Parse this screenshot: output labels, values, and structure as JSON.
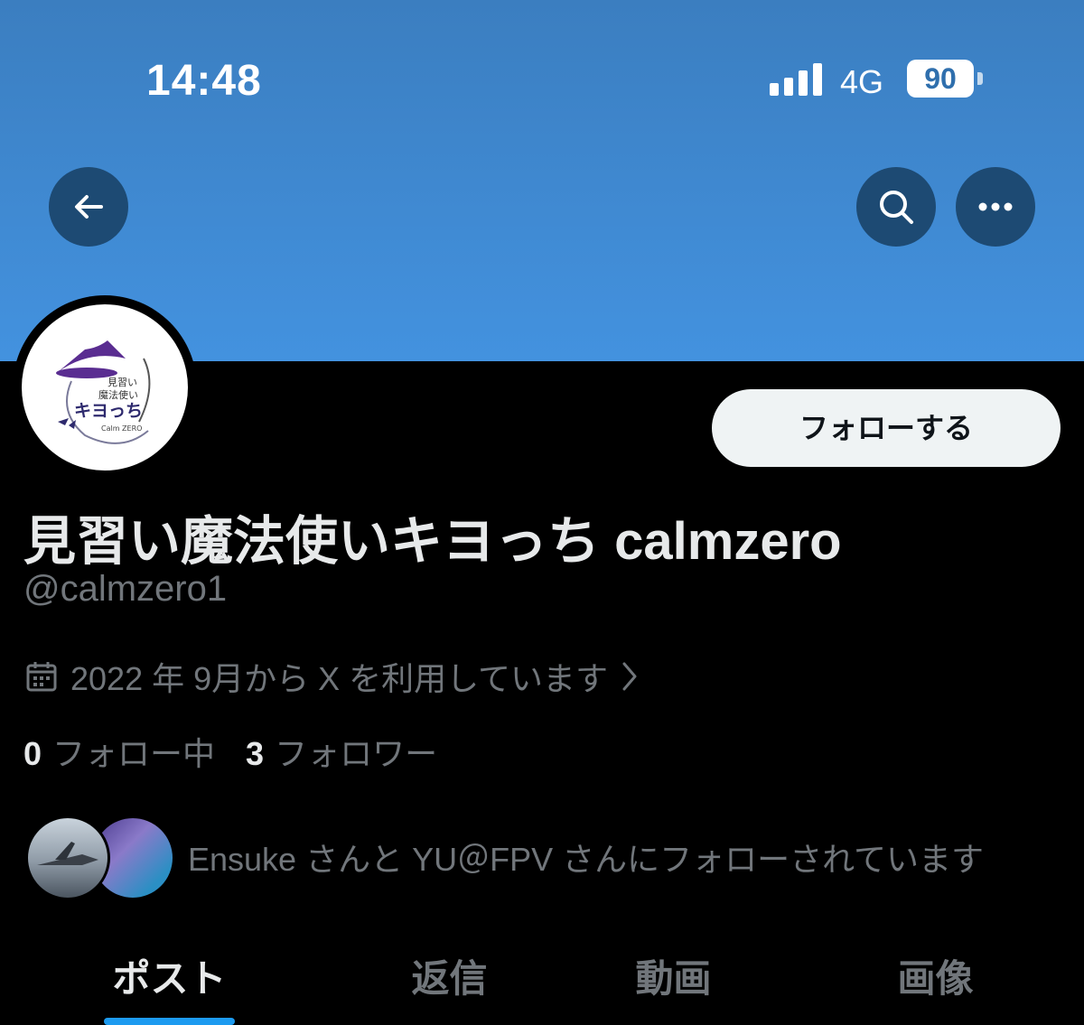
{
  "status_bar": {
    "time": "14:48",
    "network": "4G",
    "battery": "90"
  },
  "nav": {
    "back_icon": "arrow-left-icon",
    "search_icon": "search-icon",
    "more_icon": "more-horizontal-icon"
  },
  "profile": {
    "avatar_text": {
      "line1": "見習い",
      "line2": "魔法使い",
      "main": "キヨっち",
      "sub": "Calm ZERO"
    },
    "follow_label": "フォローする",
    "display_name": "見習い魔法使いキヨっち calmzero",
    "handle": "@calmzero1",
    "joined": "2022 年 9月から X を利用しています",
    "following_count": "0",
    "following_label": "フォロー中",
    "followers_count": "3",
    "followers_label": "フォロワー",
    "followed_by": "Ensuke さんと YU＠FPV さんにフォローされています"
  },
  "tabs": [
    {
      "label": "ポスト",
      "active": true
    },
    {
      "label": "返信",
      "active": false
    },
    {
      "label": "動画",
      "active": false
    },
    {
      "label": "画像",
      "active": false
    }
  ],
  "colors": {
    "banner_top": "#3b7ec0",
    "banner_bottom": "#4392df",
    "accent": "#1d9bf0",
    "muted": "#71767b"
  }
}
